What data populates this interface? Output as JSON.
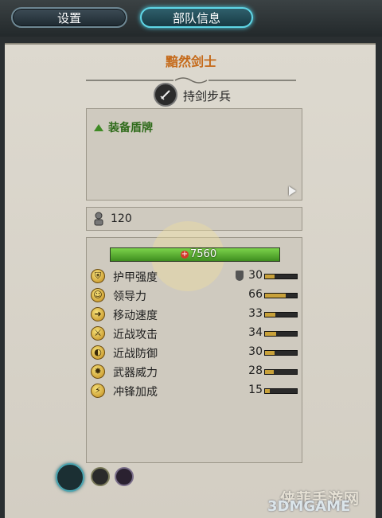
{
  "tabs": [
    {
      "label": "设置",
      "active": false
    },
    {
      "label": "部队信息",
      "active": true
    }
  ],
  "unit": {
    "name": "黯然剑士",
    "type_label": "持剑步兵",
    "type_icon": "sword-icon"
  },
  "abilities": [
    "装备盾牌"
  ],
  "men_count": "120",
  "health": "7560",
  "stats": [
    {
      "label": "护甲强度",
      "value": "30",
      "icon": "armour-icon",
      "fraction": 0.3,
      "shield": true
    },
    {
      "label": "领导力",
      "value": "66",
      "icon": "leadership-icon",
      "fraction": 0.66
    },
    {
      "label": "移动速度",
      "value": "33",
      "icon": "speed-icon",
      "fraction": 0.33
    },
    {
      "label": "近战攻击",
      "value": "34",
      "icon": "melee-attack-icon",
      "fraction": 0.34
    },
    {
      "label": "近战防御",
      "value": "30",
      "icon": "melee-defence-icon",
      "fraction": 0.3
    },
    {
      "label": "武器威力",
      "value": "28",
      "icon": "weapon-strength-icon",
      "fraction": 0.28
    },
    {
      "label": "冲锋加成",
      "value": "15",
      "icon": "charge-bonus-icon",
      "fraction": 0.15
    }
  ],
  "watermark": {
    "line1": "侠菲手游网",
    "line2": "3DMGAME"
  },
  "colors": {
    "unit_name": "#c56a1a",
    "ability": "#2f6b1b",
    "health_bar": "#5cb335",
    "active_tab_glow": "#5fd6e6"
  }
}
